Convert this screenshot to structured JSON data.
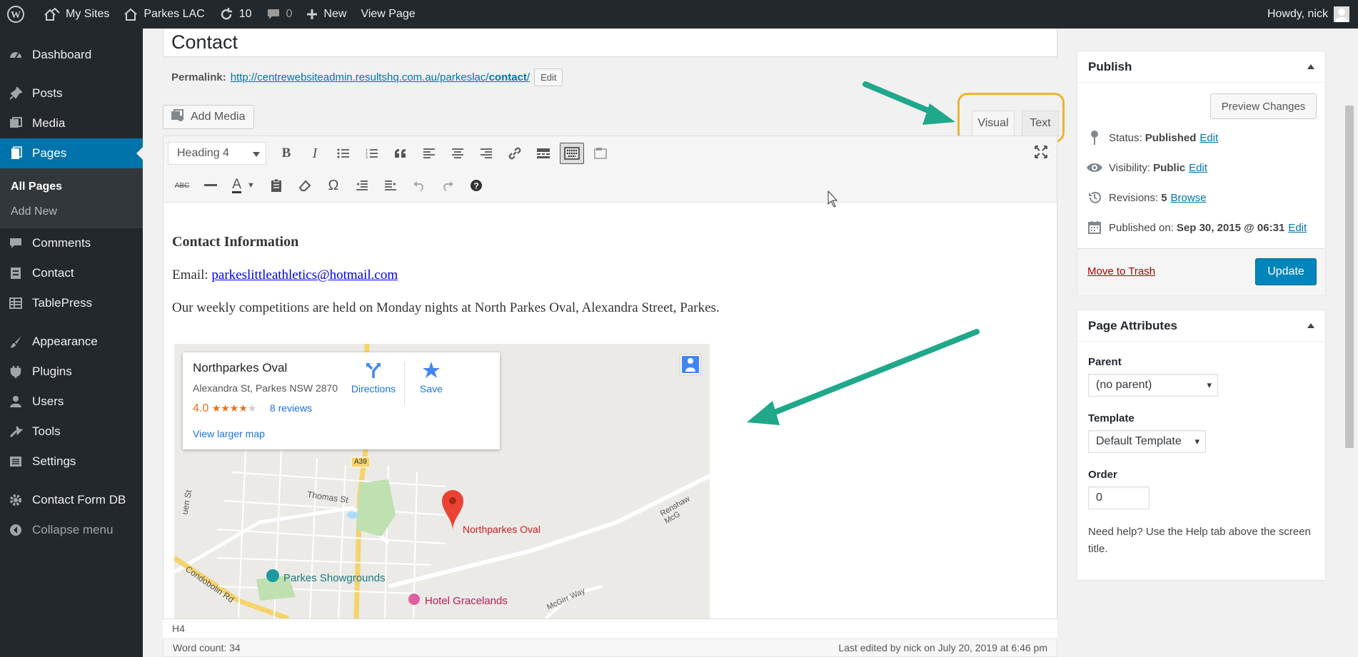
{
  "adminbar": {
    "my_sites": "My Sites",
    "site_name": "Parkes LAC",
    "updates_count": "10",
    "comments_count": "0",
    "new_label": "New",
    "view_page": "View Page",
    "howdy": "Howdy, nick"
  },
  "sidebar": {
    "items": [
      {
        "label": "Dashboard",
        "icon": "dashboard-icon"
      },
      {
        "label": "Posts",
        "icon": "pin-icon"
      },
      {
        "label": "Media",
        "icon": "media-icon"
      },
      {
        "label": "Pages",
        "icon": "page-icon"
      },
      {
        "label": "Comments",
        "icon": "comment-icon"
      },
      {
        "label": "Contact",
        "icon": "contact-icon"
      },
      {
        "label": "TablePress",
        "icon": "table-icon"
      },
      {
        "label": "Appearance",
        "icon": "brush-icon"
      },
      {
        "label": "Plugins",
        "icon": "plugin-icon"
      },
      {
        "label": "Users",
        "icon": "users-icon"
      },
      {
        "label": "Tools",
        "icon": "wrench-icon"
      },
      {
        "label": "Settings",
        "icon": "settings-icon"
      },
      {
        "label": "Contact Form DB",
        "icon": "gear-icon"
      },
      {
        "label": "Collapse menu",
        "icon": "collapse-icon"
      }
    ],
    "submenu": [
      "All Pages",
      "Add New"
    ]
  },
  "editor": {
    "title": "Contact",
    "permalink_label": "Permalink:",
    "permalink_base": "http://centrewebsiteadmin.resultshq.com.au/parkeslac/",
    "permalink_slug": "contact",
    "permalink_end": "/",
    "edit_label": "Edit",
    "add_media": "Add Media",
    "tab_visual": "Visual",
    "tab_text": "Text",
    "format": "Heading 4",
    "heading": "Contact Information",
    "email_label": "Email: ",
    "email": "parkeslittleathletics@hotmail.com",
    "paragraph": "Our weekly competitions are held on Monday nights at North Parkes Oval, Alexandra Street, Parkes.",
    "path": "H4",
    "word_count": "Word count: 34",
    "last_edited": "Last edited by nick on July 20, 2019 at 6:46 pm"
  },
  "map": {
    "place": "Northparkes Oval",
    "address": "Alexandra St, Parkes NSW 2870",
    "rating": "4.0",
    "stars": "★★★★",
    "star_empty": "★",
    "reviews": "8 reviews",
    "directions": "Directions",
    "save": "Save",
    "larger": "View larger map",
    "pin_label": "Northparkes Oval",
    "showgrounds": "Parkes Showgrounds",
    "hotel": "Hotel Gracelands",
    "road_a39": "A39",
    "thomas_st": "Thomas St",
    "condobolin": "Condobolin Rd",
    "renshaw": "Renshaw McG",
    "mcgirr": "McGirr Way",
    "ouen": "uen St"
  },
  "publish": {
    "title": "Publish",
    "preview": "Preview Changes",
    "status_label": "Status:",
    "status_value": "Published",
    "visibility_label": "Visibility:",
    "visibility_value": "Public",
    "revisions_label": "Revisions:",
    "revisions_value": "5",
    "browse": "Browse",
    "published_label": "Published on:",
    "published_value": "Sep 30, 2015 @ 06:31",
    "edit": "Edit",
    "trash": "Move to Trash",
    "update": "Update"
  },
  "attributes": {
    "title": "Page Attributes",
    "parent_label": "Parent",
    "parent_value": "(no parent)",
    "template_label": "Template",
    "template_value": "Default Template",
    "order_label": "Order",
    "order_value": "0",
    "help": "Need help? Use the Help tab above the screen title."
  },
  "colors": {
    "accent": "#0073aa",
    "highlight": "#f0b429",
    "arrow": "#1fa88a"
  }
}
